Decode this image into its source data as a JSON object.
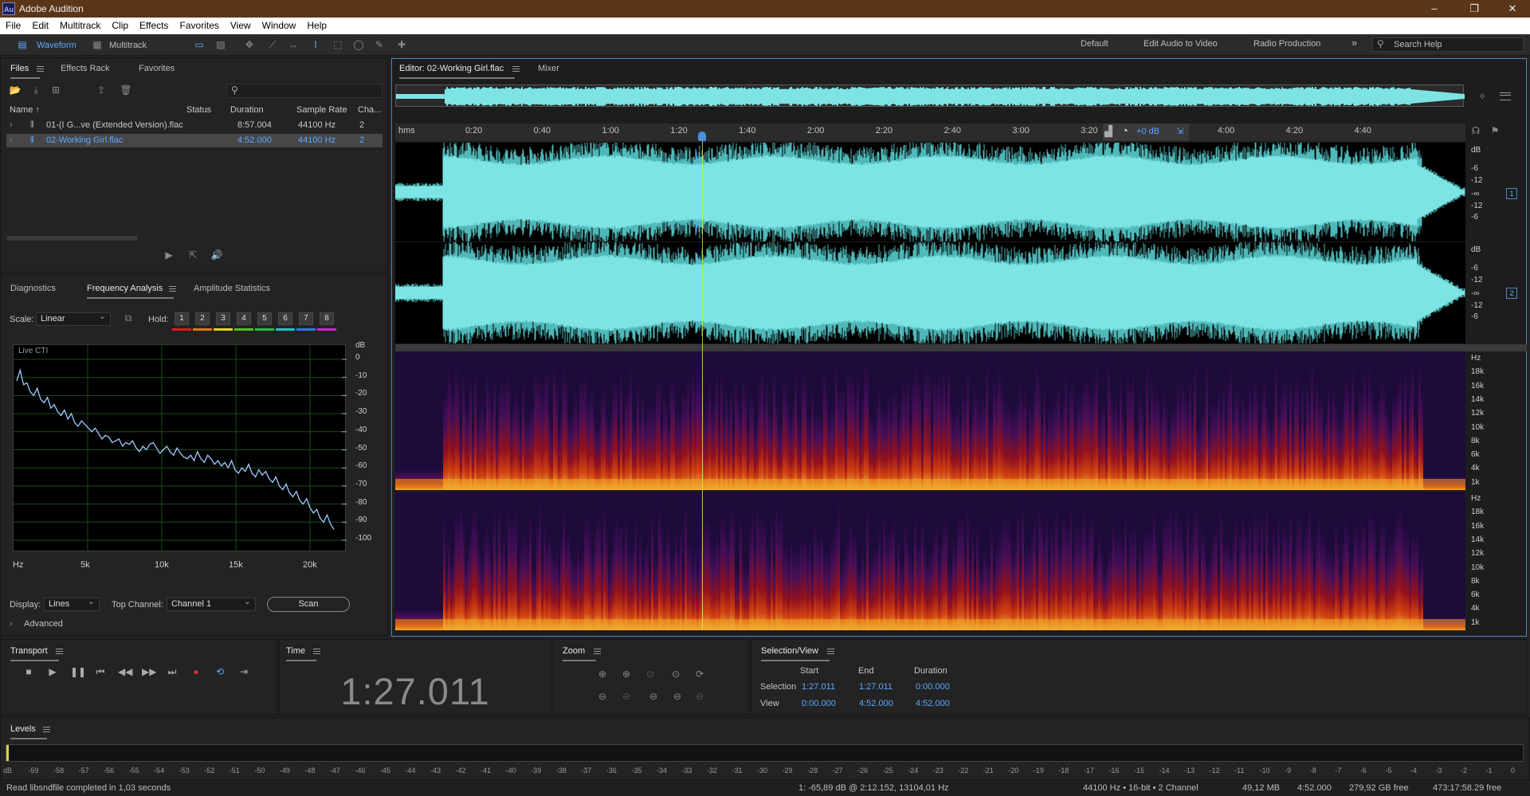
{
  "app": {
    "title": "Adobe Audition",
    "icon_text": "Au"
  },
  "window_controls": [
    "–",
    "❐",
    "✕"
  ],
  "menu": [
    "File",
    "Edit",
    "Multitrack",
    "Clip",
    "Effects",
    "Favorites",
    "View",
    "Window",
    "Help"
  ],
  "toolbar": {
    "waveform_label": "Waveform",
    "multitrack_label": "Multitrack",
    "workspaces": [
      "Default",
      "Edit Audio to Video",
      "Radio Production"
    ],
    "more_label": "»",
    "search_placeholder": "Search Help"
  },
  "files_panel": {
    "tabs": [
      "Files",
      "Effects Rack",
      "Favorites"
    ],
    "search_placeholder": "",
    "columns": [
      "Name ↑",
      "Status",
      "Duration",
      "Sample Rate",
      "Cha..."
    ],
    "rows": [
      {
        "name": "01-(I G...ve (Extended Version).flac",
        "status": "",
        "duration": "8:57.004",
        "rate": "44100 Hz",
        "channels": "2",
        "selected": false
      },
      {
        "name": "02-Working Girl.flac",
        "status": "",
        "duration": "4:52.000",
        "rate": "44100 Hz",
        "channels": "2",
        "selected": true
      }
    ]
  },
  "analysis_panel": {
    "tabs": [
      "Diagnostics",
      "Frequency Analysis",
      "Amplitude Statistics"
    ],
    "scale_label": "Scale:",
    "scale_value": "Linear",
    "hold_label": "Hold:",
    "hold_buttons": [
      "1",
      "2",
      "3",
      "4",
      "5",
      "6",
      "7",
      "8"
    ],
    "hold_colors": [
      "#e01b1b",
      "#e07a12",
      "#e0d812",
      "#55c021",
      "#2bb851",
      "#1fc1c8",
      "#2e77e0",
      "#d61fd0"
    ],
    "plot_label": "Live CTI",
    "db_header": "dB",
    "db_ticks": [
      "0",
      "-10",
      "-20",
      "-30",
      "-40",
      "-50",
      "-60",
      "-70",
      "-80",
      "-90",
      "-100"
    ],
    "hz_ticks": [
      "Hz",
      "5k",
      "10k",
      "15k",
      "20k"
    ],
    "display_label": "Display:",
    "display_value": "Lines",
    "top_channel_label": "Top Channel:",
    "top_channel_value": "Channel 1",
    "scan_label": "Scan",
    "advanced_label": "Advanced",
    "spectrum_curve_db": [
      -12,
      -6,
      -14,
      -13,
      -18,
      -20,
      -16,
      -22,
      -24,
      -21,
      -27,
      -25,
      -29,
      -31,
      -28,
      -33,
      -30,
      -35,
      -37,
      -34,
      -36,
      -38,
      -40,
      -38,
      -41,
      -44,
      -42,
      -43,
      -46,
      -45,
      -44,
      -48,
      -46,
      -47,
      -45,
      -49,
      -51,
      -48,
      -50,
      -47,
      -46,
      -49,
      -52,
      -50,
      -48,
      -51,
      -53,
      -49,
      -52,
      -54,
      -55,
      -53,
      -56,
      -51,
      -55,
      -57,
      -53,
      -55,
      -58,
      -56,
      -59,
      -57,
      -60,
      -56,
      -61,
      -63,
      -60,
      -62,
      -58,
      -63,
      -65,
      -61,
      -64,
      -62,
      -66,
      -68,
      -65,
      -70,
      -72,
      -69,
      -74,
      -76,
      -73,
      -78,
      -80,
      -77,
      -82,
      -85,
      -83,
      -88,
      -90,
      -86,
      -91,
      -94
    ]
  },
  "editor": {
    "tab": "Editor: 02-Working Girl.flac",
    "mixer_tab": "Mixer",
    "ruler_unit": "hms",
    "ruler_labels": [
      "0:20",
      "0:40",
      "1:00",
      "1:20",
      "1:40",
      "2:00",
      "2:20",
      "2:40",
      "3:00",
      "3:20",
      "3:40",
      "4:00",
      "4:20",
      "4:40"
    ],
    "gain_label": "+0 dB",
    "waveform_scale": [
      "dB",
      "-6",
      "-12",
      "-∞",
      "-12",
      "-6"
    ],
    "spec_scale": [
      "Hz",
      "18k",
      "16k",
      "14k",
      "12k",
      "10k",
      "8k",
      "6k",
      "4k",
      "1k"
    ],
    "channel_labels": [
      "1",
      "2"
    ],
    "playhead_time": "1:27.011",
    "duration_seconds": 292
  },
  "transport": {
    "title": "Transport",
    "icons": [
      "stop-icon",
      "play-icon",
      "pause-icon",
      "skip-back-icon",
      "rewind-icon",
      "fast-forward-icon",
      "skip-forward-icon",
      "record-icon",
      "loop-icon",
      "skip-selection-icon"
    ]
  },
  "time_panel": {
    "title": "Time",
    "value": "1:27.011"
  },
  "zoom_panel": {
    "title": "Zoom"
  },
  "selection_view": {
    "title": "Selection/View",
    "headers": [
      "Start",
      "End",
      "Duration"
    ],
    "selection_label": "Selection",
    "selection": [
      "1:27.011",
      "1:27.011",
      "0:00.000"
    ],
    "view_label": "View",
    "view": [
      "0:00.000",
      "4:52.000",
      "4:52.000"
    ]
  },
  "levels": {
    "title": "Levels",
    "scale": [
      "dB",
      "-59",
      "-58",
      "-57",
      "-56",
      "-55",
      "-54",
      "-53",
      "-52",
      "-51",
      "-50",
      "-49",
      "-48",
      "-47",
      "-46",
      "-45",
      "-44",
      "-43",
      "-42",
      "-41",
      "-40",
      "-39",
      "-38",
      "-37",
      "-36",
      "-35",
      "-34",
      "-33",
      "-32",
      "-31",
      "-30",
      "-29",
      "-28",
      "-27",
      "-26",
      "-25",
      "-24",
      "-23",
      "-22",
      "-21",
      "-20",
      "-19",
      "-18",
      "-17",
      "-16",
      "-15",
      "-14",
      "-13",
      "-12",
      "-11",
      "-10",
      "-9",
      "-8",
      "-7",
      "-6",
      "-5",
      "-4",
      "-3",
      "-2",
      "-1",
      "0"
    ]
  },
  "status": {
    "message": "Read libsndfile completed in 1,03 seconds",
    "cursor": "1: -65,89 dB @ 2:12.152, 13104,01 Hz",
    "format": "44100 Hz • 16-bit • 2 Channel",
    "size": "49,12 MB",
    "duration": "4:52.000",
    "disk": "279,92 GB free",
    "free_time": "473:17:58.29 free"
  },
  "colors": {
    "accent": "#5da9ff",
    "waveform": "#7de3e3",
    "editor_border": "#4c84c7"
  }
}
